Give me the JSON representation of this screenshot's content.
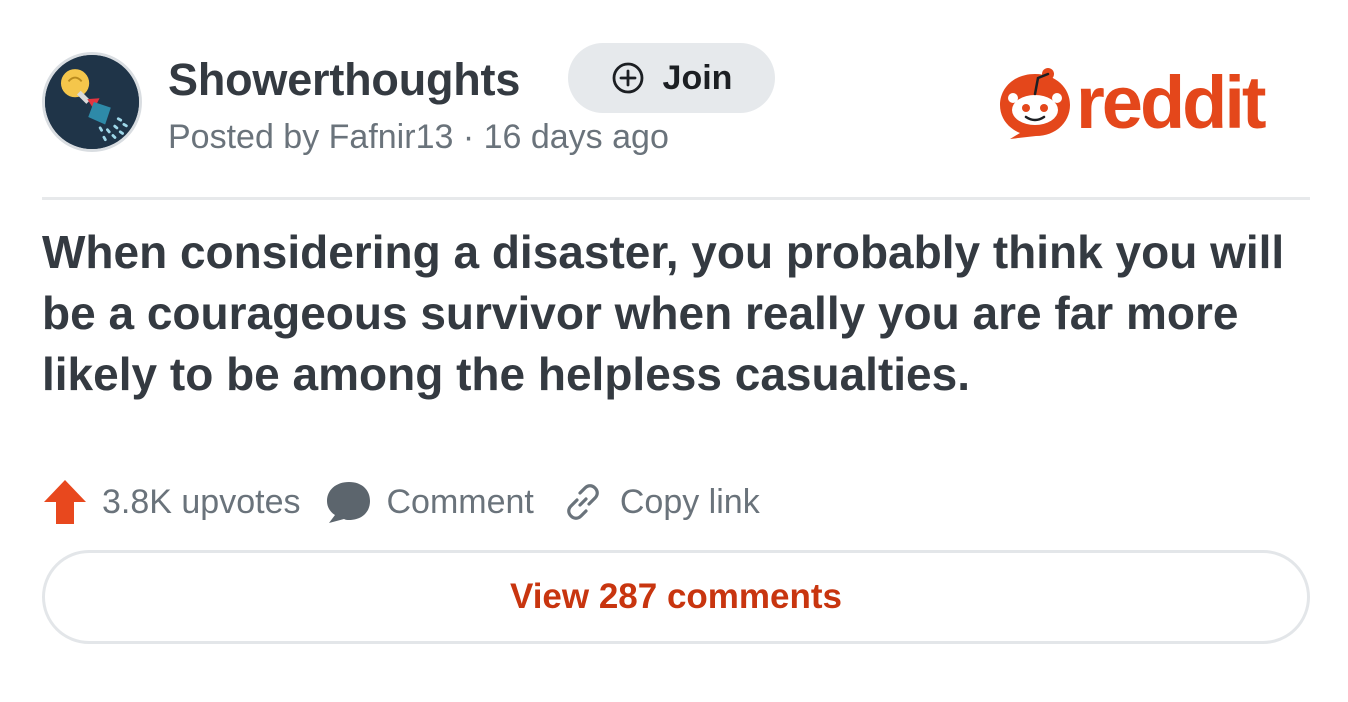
{
  "post": {
    "subreddit": "Showerthoughts",
    "join_label": "Join",
    "meta": "Posted by Fafnir13 · 16 days ago",
    "title": "When considering a disaster, you probably think you will be a courageous survivor when really you are far more likely to be among the helpless casualties."
  },
  "brand": {
    "wordmark": "reddit",
    "icon": "snoo-icon",
    "color": "#e4471b"
  },
  "actions": {
    "upvotes": "3.8K upvotes",
    "comment": "Comment",
    "copy_link": "Copy link"
  },
  "footer": {
    "view_comments": "View 287 comments"
  },
  "colors": {
    "upvote": "#e8481e",
    "link_text": "#c8350f",
    "text_primary": "#343a41",
    "text_secondary": "#6a737b"
  }
}
